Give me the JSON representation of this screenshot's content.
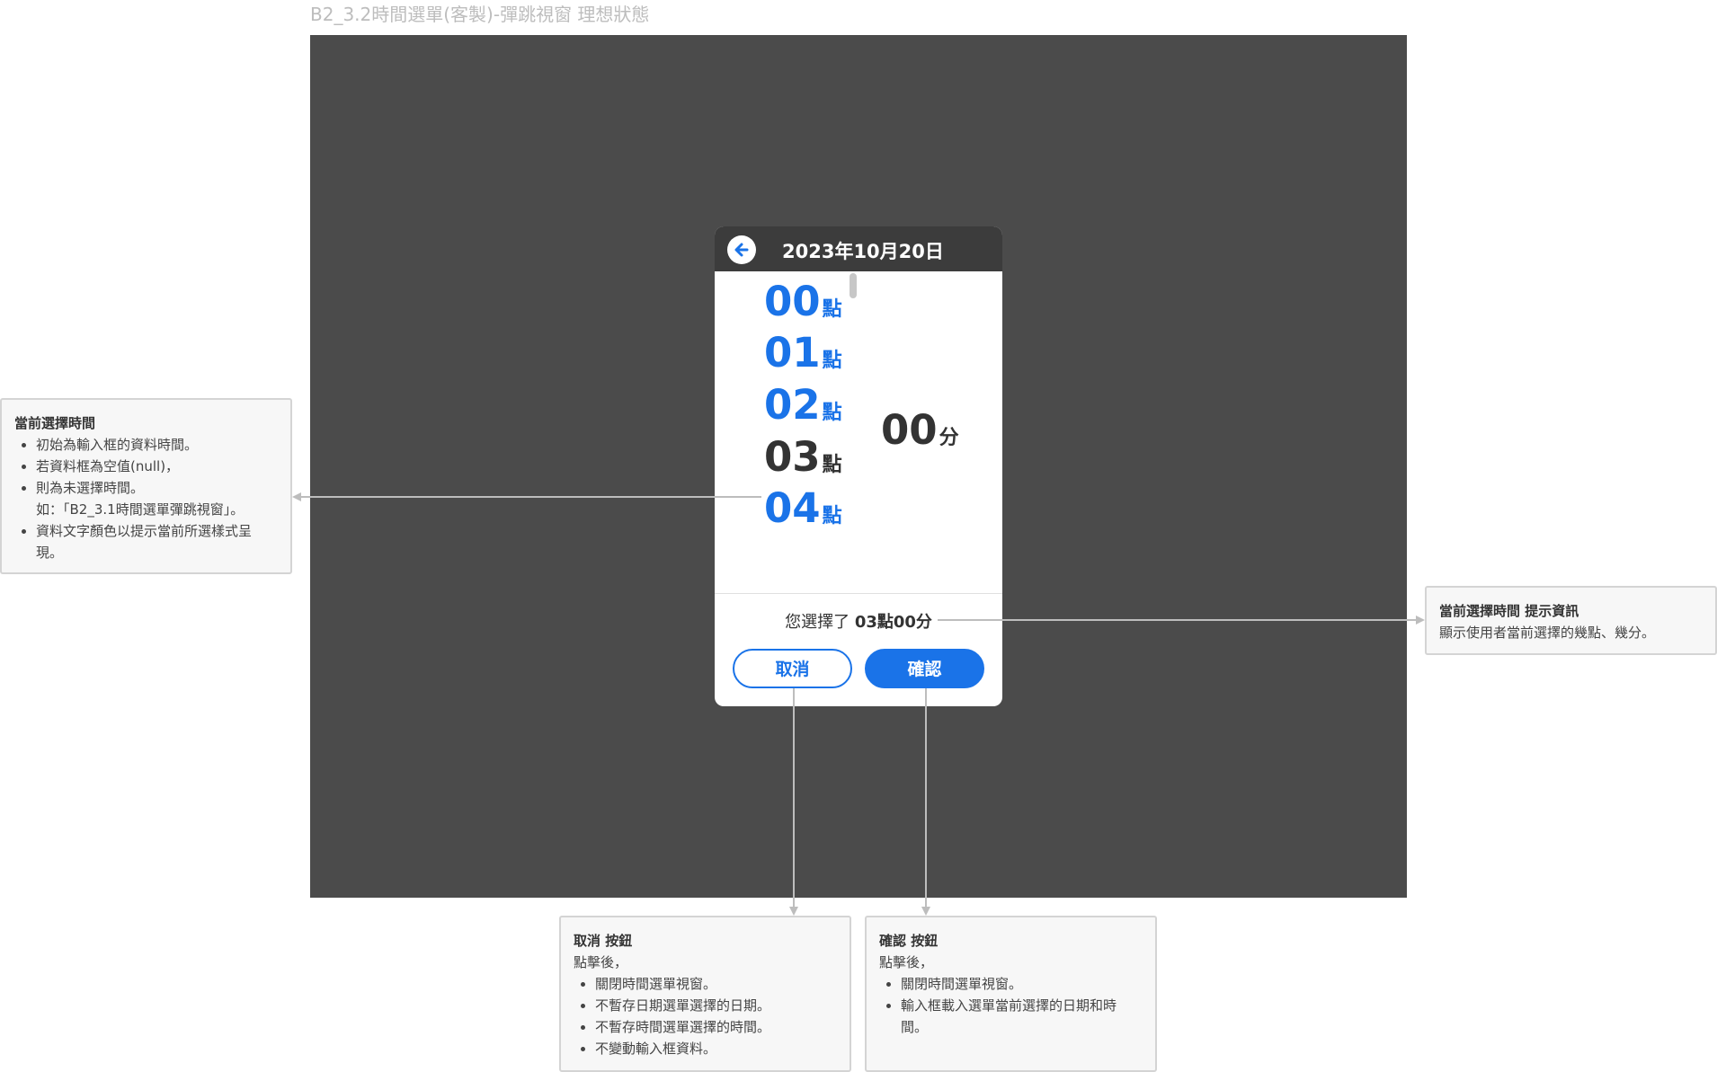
{
  "frame_title": "B2_3.2時間選單(客製)-彈跳視窗 理想狀態",
  "modal": {
    "back_icon": "arrow-left-icon",
    "header_date": "2023年10月20日",
    "hours": [
      {
        "num": "00",
        "unit": "點"
      },
      {
        "num": "01",
        "unit": "點"
      },
      {
        "num": "02",
        "unit": "點"
      },
      {
        "num": "03",
        "unit": "點"
      },
      {
        "num": "04",
        "unit": "點"
      }
    ],
    "minute": {
      "num": "00",
      "unit": "分"
    },
    "summary_prefix": "您選擇了",
    "summary_value": "03點00分",
    "cancel_label": "取消",
    "confirm_label": "確認"
  },
  "notes": {
    "left": {
      "title": "當前選擇時間",
      "items": [
        "初始為輸入框的資料時間。",
        "若資料框為空值(null)，",
        "則為未選擇時間。",
        "如：「B2_3.1時間選單彈跳視窗」。",
        "資料文字顏色以提示當前所選樣式呈現。"
      ]
    },
    "right": {
      "title": "當前選擇時間 提示資訊",
      "text": "顯示使用者當前選擇的幾點、幾分。"
    },
    "cancel": {
      "title": "取消 按鈕",
      "intro": "點擊後，",
      "items": [
        "關閉時間選單視窗。",
        "不暫存日期選單選擇的日期。",
        "不暫存時間選單選擇的時間。",
        "不變動輸入框資料。"
      ]
    },
    "confirm": {
      "title": "確認 按鈕",
      "intro": "點擊後，",
      "items": [
        "關閉時間選單視窗。",
        "輸入框載入選單當前選擇的日期和時間。"
      ]
    }
  },
  "colors": {
    "accent": "#1a73e8",
    "frame_bg": "#4b4b4b",
    "header_bg": "#3c3c3c",
    "selected_text": "#333333"
  }
}
